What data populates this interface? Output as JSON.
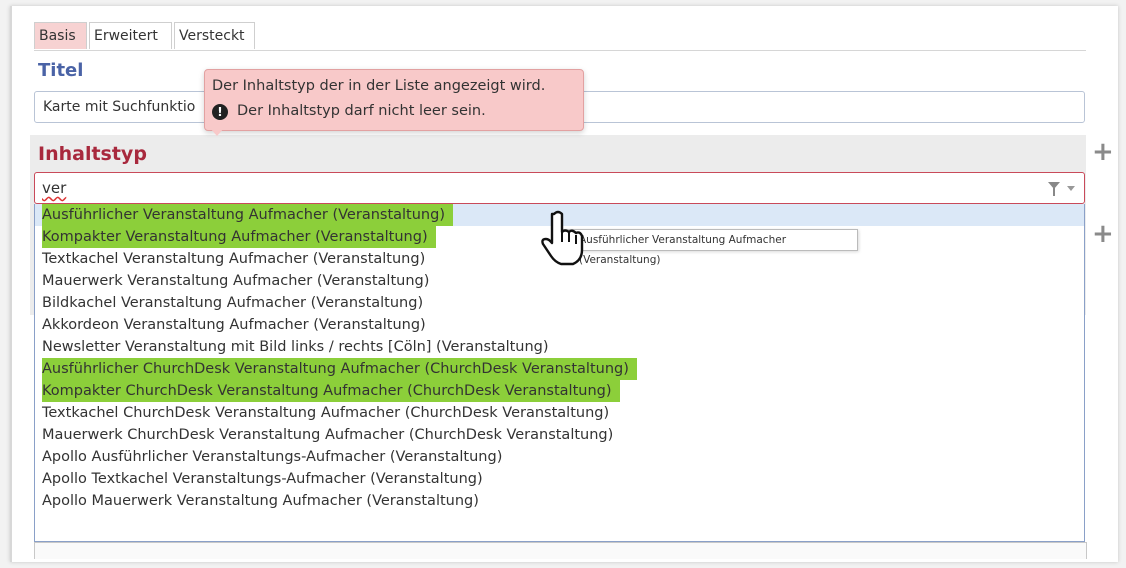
{
  "tabs": [
    "Basis",
    "Erweitert",
    "Versteckt"
  ],
  "titel": {
    "label": "Titel",
    "value": "Karte mit Suchfunktio"
  },
  "tooltip": {
    "line1": "Der Inhaltstyp der in der Liste angezeigt wird.",
    "line2": "Der Inhaltstyp darf nicht leer sein.",
    "icon": "alert-icon"
  },
  "inhaltstyp": {
    "label": "Inhaltstyp",
    "input_value": "ver",
    "options": [
      "Ausführlicher Veranstaltung Aufmacher (Veranstaltung)",
      "Kompakter Veranstaltung Aufmacher (Veranstaltung)",
      "Textkachel Veranstaltung Aufmacher (Veranstaltung)",
      "Mauerwerk Veranstaltung Aufmacher (Veranstaltung)",
      "Bildkachel Veranstaltung Aufmacher (Veranstaltung)",
      "Akkordeon Veranstaltung Aufmacher (Veranstaltung)",
      "Newsletter Veranstaltung mit Bild links / rechts [Cöln] (Veranstaltung)",
      "Ausführlicher ChurchDesk Veranstaltung Aufmacher (ChurchDesk Veranstaltung)",
      "Kompakter ChurchDesk Veranstaltung Aufmacher (ChurchDesk Veranstaltung)",
      "Textkachel ChurchDesk Veranstaltung Aufmacher (ChurchDesk Veranstaltung)",
      "Mauerwerk ChurchDesk Veranstaltung Aufmacher (ChurchDesk Veranstaltung)",
      "Apollo Ausführlicher Veranstaltungs-Aufmacher (Veranstaltung)",
      "Apollo Textkachel Veranstaltungs-Aufmacher (Veranstaltung)",
      "Apollo Mauerwerk Veranstaltung Aufmacher (Veranstaltung)"
    ],
    "highlighted_options": [
      0,
      1,
      7,
      8
    ],
    "hover_hint": "Ausführlicher Veranstaltung Aufmacher (Veranstaltung)"
  },
  "colors": {
    "active_tab": "#f7d2d2",
    "titel_label": "#4a63a6",
    "inhaltstyp_label": "#a8293d",
    "highlight": "#8ccf3a",
    "tooltip_bg": "#f8c9c9"
  }
}
